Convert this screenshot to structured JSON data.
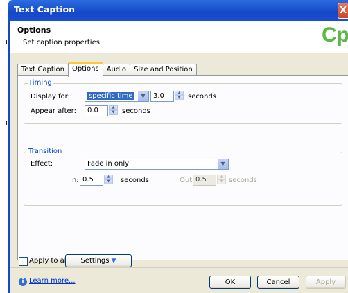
{
  "window": {
    "title": "Text Caption",
    "close_glyph": "X"
  },
  "header": {
    "title": "Options",
    "subtitle": "Set caption properties.",
    "logo": "Cp"
  },
  "tabs": [
    {
      "label": "Text Caption",
      "active": false
    },
    {
      "label": "Options",
      "active": true
    },
    {
      "label": "Audio",
      "active": false
    },
    {
      "label": "Size and Position",
      "active": false
    }
  ],
  "timing": {
    "legend": "Timing",
    "display_for_label": "Display for:",
    "display_for_value": "specific time",
    "duration_value": "3.0",
    "duration_unit": "seconds",
    "appear_after_label": "Appear after:",
    "appear_after_value": "0.0",
    "appear_after_unit": "seconds"
  },
  "transition": {
    "legend": "Transition",
    "effect_label": "Effect:",
    "effect_value": "Fade in only",
    "in_label": "In:",
    "in_value": "0.5",
    "in_unit": "seconds",
    "out_label": "Out:",
    "out_value": "0.5",
    "out_unit": "seconds"
  },
  "footer": {
    "apply_to_all": "Apply to all",
    "settings": "Settings",
    "learn_more": "Learn more...",
    "ok": "OK",
    "cancel": "Cancel",
    "apply": "Apply"
  },
  "icons": {
    "info": "info-icon",
    "dropdown": "chevron-down-icon",
    "spin_up": "spin-up-icon",
    "spin_down": "spin-down-icon"
  },
  "colors": {
    "titlebar": "#1548c9",
    "logo": "#59b846",
    "legend": "#0046d5",
    "selection": "#316ac5"
  }
}
